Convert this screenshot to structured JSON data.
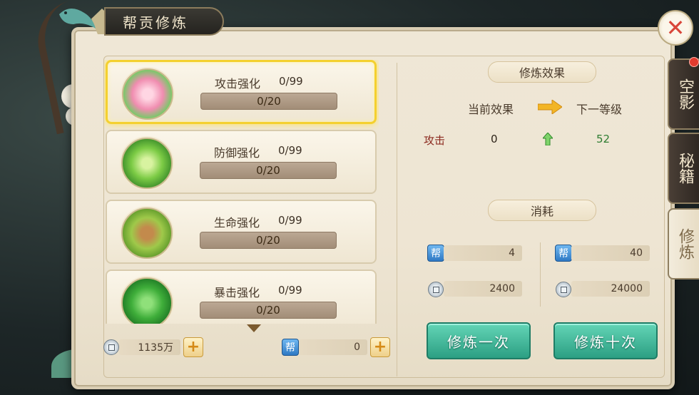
{
  "panel_title": "帮贡修炼",
  "side_tabs": [
    {
      "label": "空影",
      "active": false
    },
    {
      "label": "秘籍",
      "active": false
    },
    {
      "label": "修炼",
      "active": true
    }
  ],
  "skills": [
    {
      "name": "攻击强化",
      "level": "0/99",
      "progress_text": "0/20",
      "selected": true,
      "icon": "lotus-icon"
    },
    {
      "name": "防御强化",
      "level": "0/99",
      "progress_text": "0/20",
      "selected": false,
      "icon": "swirl-icon"
    },
    {
      "name": "生命强化",
      "level": "0/99",
      "progress_text": "0/20",
      "selected": false,
      "icon": "gourd-icon"
    },
    {
      "name": "暴击强化",
      "level": "0/99",
      "progress_text": "0/20",
      "selected": false,
      "icon": "leaves-icon"
    }
  ],
  "currency": {
    "coins": "1135万",
    "guild_contribution": "0",
    "guild_icon_char": "帮"
  },
  "effect": {
    "section_title": "修炼效果",
    "current_label": "当前效果",
    "next_label": "下一等级",
    "stat_name": "攻击",
    "current_value": "0",
    "next_value": "52"
  },
  "cost": {
    "section_title": "消耗",
    "once": {
      "contribution": "4",
      "coins": "2400"
    },
    "ten": {
      "contribution": "40",
      "coins": "24000"
    }
  },
  "buttons": {
    "train_once": "修炼一次",
    "train_ten": "修炼十次"
  },
  "colors": {
    "selected_border": "#f4d02f",
    "button_green": "#2c9f83",
    "stat_red": "#8b2a1f",
    "next_value_green": "#2e7d32"
  }
}
